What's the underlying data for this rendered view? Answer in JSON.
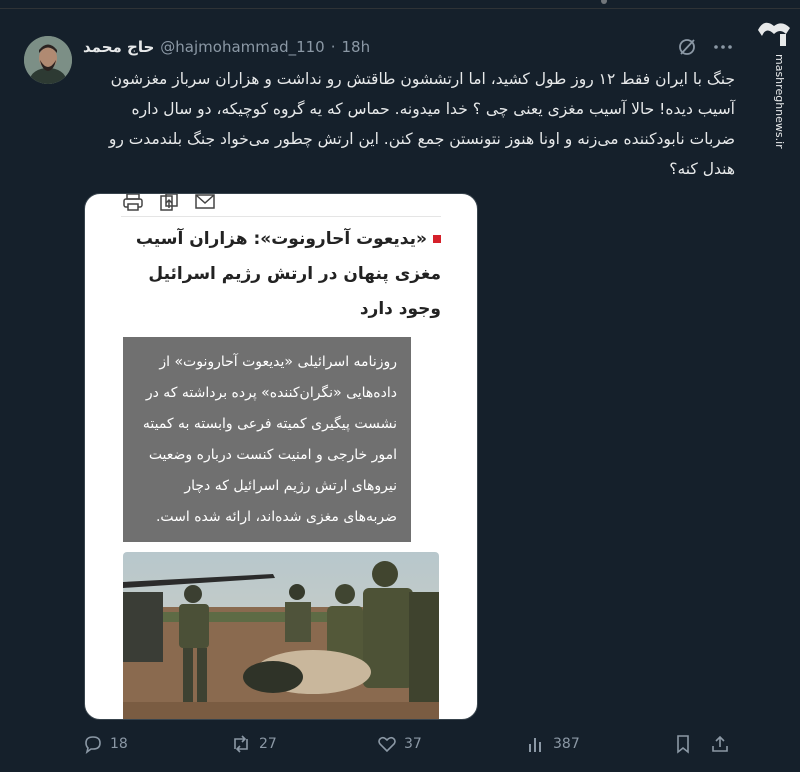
{
  "tweet": {
    "display_name": "حاج محمد",
    "handle": "@hajmohammad_110",
    "separator": "·",
    "time": "18h",
    "text": "جنگ با ایران فقط ۱۲ روز طول کشید، اما ارتششون طاقتش رو نداشت و هزاران سرباز مغزشون آسیب دیده! حالا آسیب مغزی یعنی چی ؟ خدا میدونه. حماس که یه گروه کوچیکه، دو سال داره ضربات نابودکننده می‌زنه و اونا هنوز نتونستن جمع کنن. این ارتش چطور می‌خواد جنگ بلندمدت رو هندل کنه؟"
  },
  "watermark": {
    "logo_text": "مشرق",
    "url": "mashreghnews.ir"
  },
  "card": {
    "title": "«یدیعوت آحارونوت»: هزاران آسیب مغزی پنهان در ارتش رژیم اسرائیل وجود دارد",
    "summary": "روزنامه اسرائیلی «یدیعوت آحارونوت» از داده‌هایی «نگران‌کننده» پرده برداشته که در نشست پیگیری کمیته فرعی وابسته به کمیته امور خارجی و امنیت کنست درباره وضعیت نیروهای ارتش رژیم اسرائیل که دچار ضربه‌های مغزی شده‌اند، ارائه شده است.",
    "accent_color": "#d5202a"
  },
  "actions": {
    "replies": "18",
    "reposts": "27",
    "likes": "37",
    "views": "387"
  },
  "icons": [
    "grok-icon",
    "more-icon",
    "reply-icon",
    "repost-icon",
    "like-icon",
    "views-icon",
    "bookmark-icon",
    "share-icon",
    "print-icon",
    "copy-icon",
    "mail-icon"
  ],
  "colors": {
    "background": "#15202b",
    "text": "#e7e9ea",
    "muted": "#8b98a5"
  }
}
